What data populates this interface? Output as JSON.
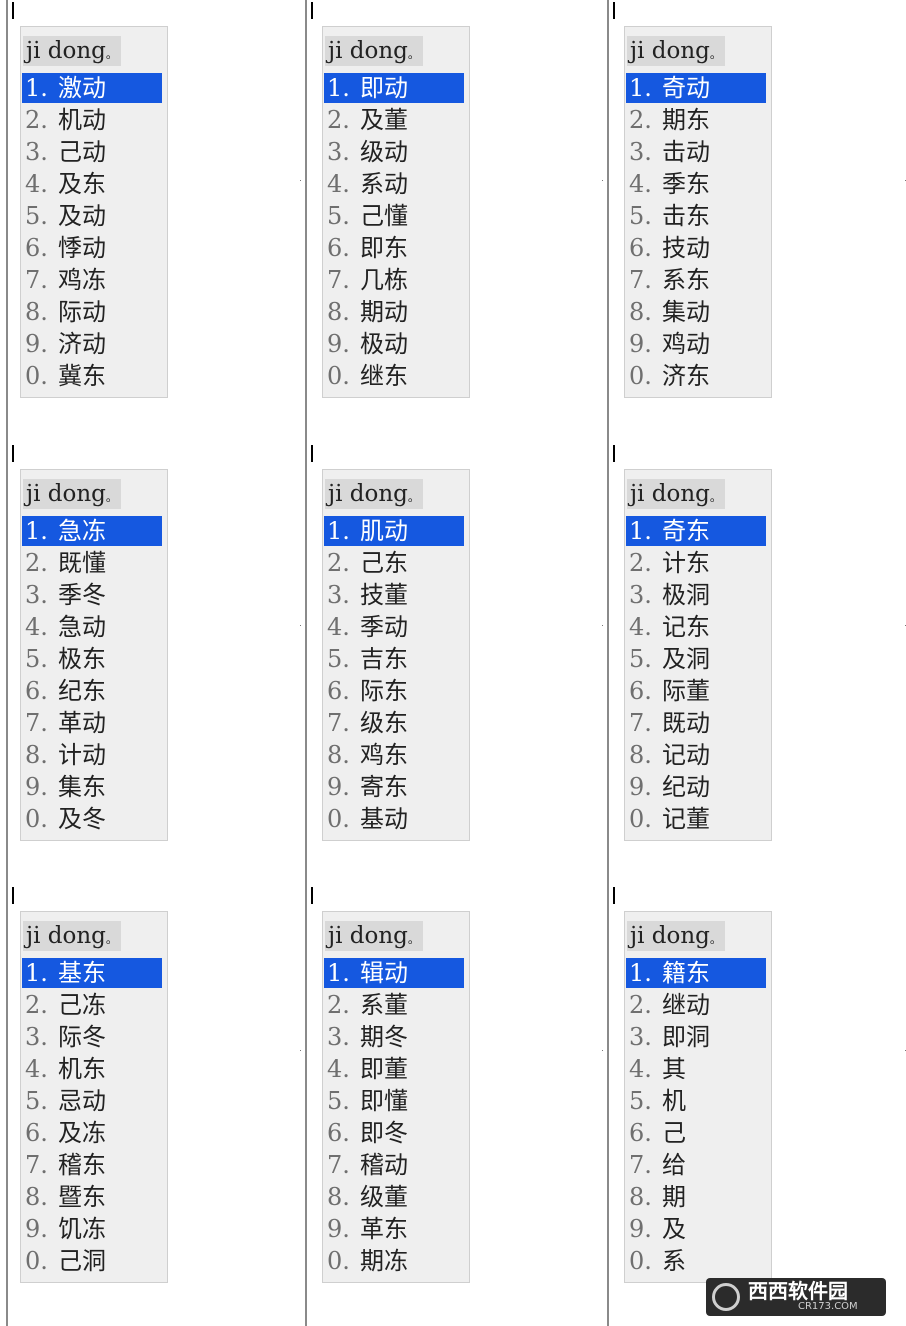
{
  "composition": "ji dong",
  "panels": [
    {
      "candidates": [
        {
          "num": "1.",
          "text": "激动",
          "selected": true
        },
        {
          "num": "2.",
          "text": "机动"
        },
        {
          "num": "3.",
          "text": "己动"
        },
        {
          "num": "4.",
          "text": "及东"
        },
        {
          "num": "5.",
          "text": "及动"
        },
        {
          "num": "6.",
          "text": "悸动"
        },
        {
          "num": "7.",
          "text": "鸡冻"
        },
        {
          "num": "8.",
          "text": "际动"
        },
        {
          "num": "9.",
          "text": "济动"
        },
        {
          "num": "0.",
          "text": "冀东"
        }
      ]
    },
    {
      "candidates": [
        {
          "num": "1.",
          "text": "即动",
          "selected": true
        },
        {
          "num": "2.",
          "text": "及董"
        },
        {
          "num": "3.",
          "text": "级动"
        },
        {
          "num": "4.",
          "text": "系动"
        },
        {
          "num": "5.",
          "text": "己懂"
        },
        {
          "num": "6.",
          "text": "即东"
        },
        {
          "num": "7.",
          "text": "几栋"
        },
        {
          "num": "8.",
          "text": "期动"
        },
        {
          "num": "9.",
          "text": "极动"
        },
        {
          "num": "0.",
          "text": "继东"
        }
      ]
    },
    {
      "candidates": [
        {
          "num": "1.",
          "text": "奇动",
          "selected": true
        },
        {
          "num": "2.",
          "text": "期东"
        },
        {
          "num": "3.",
          "text": "击动"
        },
        {
          "num": "4.",
          "text": "季东"
        },
        {
          "num": "5.",
          "text": "击东"
        },
        {
          "num": "6.",
          "text": "技动"
        },
        {
          "num": "7.",
          "text": "系东"
        },
        {
          "num": "8.",
          "text": "集动"
        },
        {
          "num": "9.",
          "text": "鸡动"
        },
        {
          "num": "0.",
          "text": "济东"
        }
      ]
    },
    {
      "candidates": [
        {
          "num": "1.",
          "text": "急冻",
          "selected": true
        },
        {
          "num": "2.",
          "text": "既懂"
        },
        {
          "num": "3.",
          "text": "季冬"
        },
        {
          "num": "4.",
          "text": "急动"
        },
        {
          "num": "5.",
          "text": "极东"
        },
        {
          "num": "6.",
          "text": "纪东"
        },
        {
          "num": "7.",
          "text": "革动"
        },
        {
          "num": "8.",
          "text": "计动"
        },
        {
          "num": "9.",
          "text": "集东"
        },
        {
          "num": "0.",
          "text": "及冬"
        }
      ]
    },
    {
      "candidates": [
        {
          "num": "1.",
          "text": "肌动",
          "selected": true
        },
        {
          "num": "2.",
          "text": "己东"
        },
        {
          "num": "3.",
          "text": "技董"
        },
        {
          "num": "4.",
          "text": "季动"
        },
        {
          "num": "5.",
          "text": "吉东"
        },
        {
          "num": "6.",
          "text": "际东"
        },
        {
          "num": "7.",
          "text": "级东"
        },
        {
          "num": "8.",
          "text": "鸡东"
        },
        {
          "num": "9.",
          "text": "寄东"
        },
        {
          "num": "0.",
          "text": "基动"
        }
      ]
    },
    {
      "candidates": [
        {
          "num": "1.",
          "text": "奇东",
          "selected": true
        },
        {
          "num": "2.",
          "text": "计东"
        },
        {
          "num": "3.",
          "text": "极洞"
        },
        {
          "num": "4.",
          "text": "记东"
        },
        {
          "num": "5.",
          "text": "及洞"
        },
        {
          "num": "6.",
          "text": "际董"
        },
        {
          "num": "7.",
          "text": "既动"
        },
        {
          "num": "8.",
          "text": "记动"
        },
        {
          "num": "9.",
          "text": "纪动"
        },
        {
          "num": "0.",
          "text": "记董"
        }
      ]
    },
    {
      "candidates": [
        {
          "num": "1.",
          "text": "基东",
          "selected": true
        },
        {
          "num": "2.",
          "text": "己冻"
        },
        {
          "num": "3.",
          "text": "际冬"
        },
        {
          "num": "4.",
          "text": "机东"
        },
        {
          "num": "5.",
          "text": "忌动"
        },
        {
          "num": "6.",
          "text": "及冻"
        },
        {
          "num": "7.",
          "text": "稽东"
        },
        {
          "num": "8.",
          "text": "暨东"
        },
        {
          "num": "9.",
          "text": "饥冻"
        },
        {
          "num": "0.",
          "text": "己洞"
        }
      ]
    },
    {
      "candidates": [
        {
          "num": "1.",
          "text": "辑动",
          "selected": true
        },
        {
          "num": "2.",
          "text": "系董"
        },
        {
          "num": "3.",
          "text": "期冬"
        },
        {
          "num": "4.",
          "text": "即董"
        },
        {
          "num": "5.",
          "text": "即懂"
        },
        {
          "num": "6.",
          "text": "即冬"
        },
        {
          "num": "7.",
          "text": "稽动"
        },
        {
          "num": "8.",
          "text": "级董"
        },
        {
          "num": "9.",
          "text": "革东"
        },
        {
          "num": "0.",
          "text": "期冻"
        }
      ]
    },
    {
      "candidates": [
        {
          "num": "1.",
          "text": "籍东",
          "selected": true
        },
        {
          "num": "2.",
          "text": "继动"
        },
        {
          "num": "3.",
          "text": "即洞"
        },
        {
          "num": "4.",
          "text": "其"
        },
        {
          "num": "5.",
          "text": "机"
        },
        {
          "num": "6.",
          "text": "己"
        },
        {
          "num": "7.",
          "text": "给"
        },
        {
          "num": "8.",
          "text": "期"
        },
        {
          "num": "9.",
          "text": "及"
        },
        {
          "num": "0.",
          "text": "系"
        }
      ]
    }
  ],
  "watermark": {
    "title": "西西软件园",
    "subtitle": "CR173.COM"
  },
  "colors": {
    "selection": "#1558e0",
    "panel_bg": "#efefef",
    "composition_bg": "#d9d9d9"
  }
}
